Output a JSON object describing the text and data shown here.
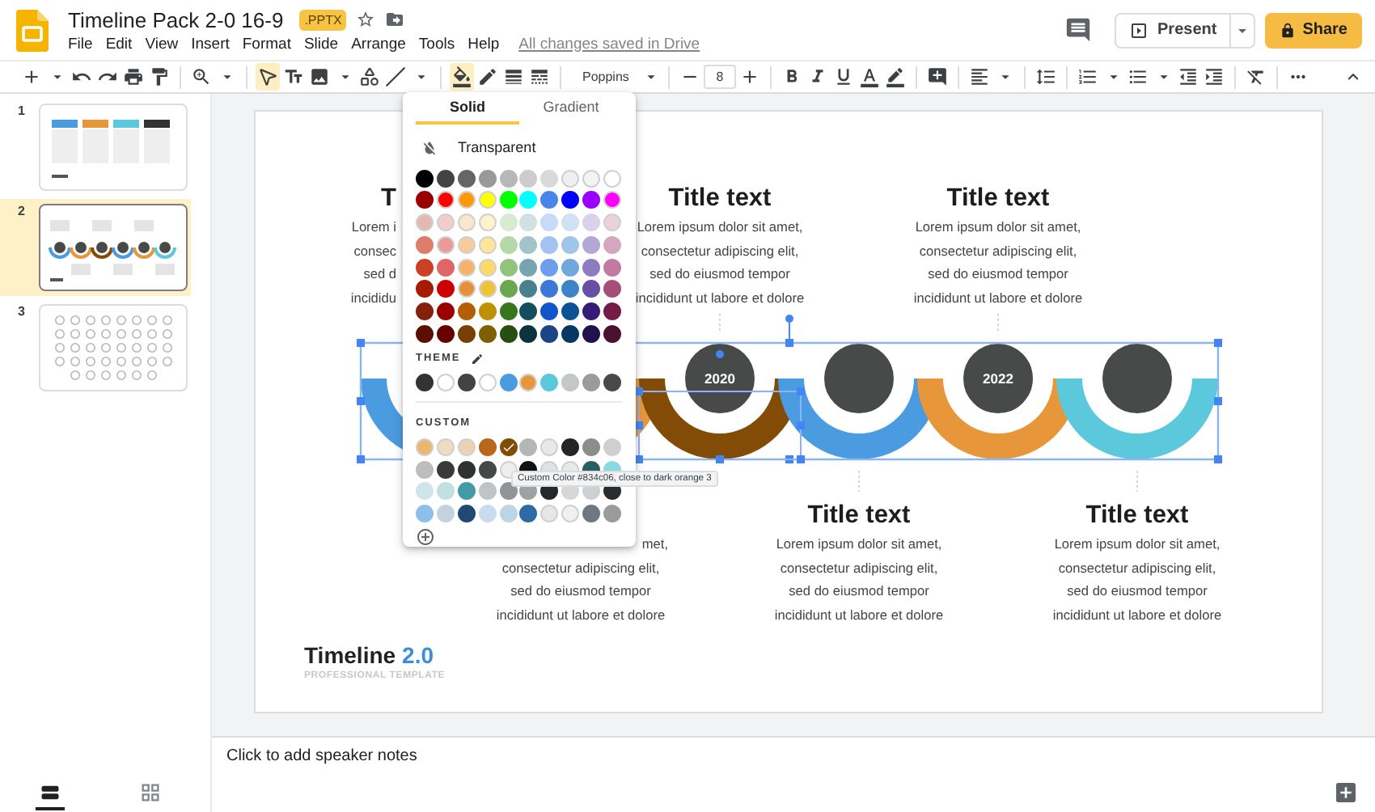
{
  "header": {
    "title": "Timeline Pack 2-0 16-9",
    "badge": ".PPTX",
    "menus": [
      "File",
      "Edit",
      "View",
      "Insert",
      "Format",
      "Slide",
      "Arrange",
      "Tools",
      "Help"
    ],
    "save_status": "All changes saved in Drive",
    "present": "Present",
    "share": "Share"
  },
  "toolbar": {
    "select_selected": true,
    "fill_open": true,
    "font": "Poppins",
    "font_size": "8"
  },
  "slides": [
    {
      "number": "1",
      "kind": "cards",
      "selected": false
    },
    {
      "number": "2",
      "kind": "arcs",
      "selected": true
    },
    {
      "number": "3",
      "kind": "icons",
      "selected": false
    }
  ],
  "slide": {
    "timeline": [
      {
        "color": "#4a9be0",
        "title": "T",
        "lines": [
          "Lorem i",
          "consec",
          "sed d",
          "incididu"
        ]
      },
      {
        "color": "#e8963a",
        "lines": [
          "met,",
          "consectetur adipiscing elit,",
          "sed do eiusmod tempor",
          "incididunt ut labore et dolore"
        ]
      },
      {
        "color": "#834c06",
        "year": "2020",
        "title": "Title text",
        "lines": [
          "Lorem ipsum dolor sit amet,",
          "consectetur adipiscing elit,",
          "sed do eiusmod tempor",
          "incididunt ut labore et dolore"
        ]
      },
      {
        "color": "#4a9be0",
        "title": "Title text",
        "lines": [
          "Lorem ipsum dolor sit amet,",
          "consectetur adipiscing elit,",
          "sed do eiusmod tempor",
          "incididunt ut labore et dolore"
        ]
      },
      {
        "color": "#e8963a",
        "year": "2022",
        "title": "Title text",
        "lines": [
          "Lorem ipsum dolor sit amet,",
          "consectetur adipiscing elit,",
          "sed do eiusmod tempor",
          "incididunt ut labore et dolore"
        ]
      },
      {
        "color": "#5bc8dc",
        "title": "Title text",
        "lines": [
          "Lorem ipsum dolor sit amet,",
          "consectetur adipiscing elit,",
          "sed do eiusmod tempor",
          "incididunt ut labore et dolore"
        ]
      }
    ],
    "brand": {
      "name": "Timeline",
      "version": "2.0",
      "subtitle": "PROFESSIONAL TEMPLATE"
    }
  },
  "color_picker": {
    "tabs": [
      {
        "label": "Solid",
        "selected": true
      },
      {
        "label": "Gradient",
        "selected": false
      }
    ],
    "transparent": "Transparent",
    "palette": [
      [
        {
          "color": "#000000"
        },
        {
          "color": "#434343"
        },
        {
          "color": "#666666"
        },
        {
          "color": "#999999"
        },
        {
          "color": "#b7b7b7"
        },
        {
          "color": "#cccccc"
        },
        {
          "color": "#d9d9d9"
        },
        {
          "color": "#efefef"
        },
        {
          "color": "#f3f3f3"
        },
        {
          "color": "#ffffff"
        }
      ],
      [
        {
          "color": "#980000"
        },
        {
          "color": "#ff0000"
        },
        {
          "color": "#ff9900"
        },
        {
          "color": "#ffff00"
        },
        {
          "color": "#00ff00"
        },
        {
          "color": "#00ffff"
        },
        {
          "color": "#4a86e8"
        },
        {
          "color": "#0000ff"
        },
        {
          "color": "#9900ff"
        },
        {
          "color": "#ff00ff"
        }
      ],
      [
        {
          "color": "#e6b8af"
        },
        {
          "color": "#f4cccc"
        },
        {
          "color": "#fce5cd"
        },
        {
          "color": "#fff2cc"
        },
        {
          "color": "#d9ead3"
        },
        {
          "color": "#d0e0e3"
        },
        {
          "color": "#c9daf8"
        },
        {
          "color": "#cfe2f3"
        },
        {
          "color": "#d9d2e9"
        },
        {
          "color": "#ead1dc"
        }
      ],
      [
        {
          "color": "#dd7e6b"
        },
        {
          "color": "#ea9999"
        },
        {
          "color": "#f9cb9c"
        },
        {
          "color": "#ffe599"
        },
        {
          "color": "#b6d7a8"
        },
        {
          "color": "#a2c4c9"
        },
        {
          "color": "#a4c2f4"
        },
        {
          "color": "#9fc5e8"
        },
        {
          "color": "#b4a7d6"
        },
        {
          "color": "#d5a6bd"
        }
      ],
      [
        {
          "color": "#cc4125"
        },
        {
          "color": "#e06666"
        },
        {
          "color": "#f6b26b"
        },
        {
          "color": "#ffd966"
        },
        {
          "color": "#93c47d"
        },
        {
          "color": "#76a5af"
        },
        {
          "color": "#6d9eeb"
        },
        {
          "color": "#6fa8dc"
        },
        {
          "color": "#8e7cc3"
        },
        {
          "color": "#c27ba0"
        }
      ],
      [
        {
          "color": "#a61c00"
        },
        {
          "color": "#cc0000"
        },
        {
          "color": "#e69138"
        },
        {
          "color": "#f1c232"
        },
        {
          "color": "#6aa84f"
        },
        {
          "color": "#45818e"
        },
        {
          "color": "#3c78d8"
        },
        {
          "color": "#3d85c6"
        },
        {
          "color": "#674ea7"
        },
        {
          "color": "#a64d79"
        }
      ],
      [
        {
          "color": "#85200c"
        },
        {
          "color": "#990000"
        },
        {
          "color": "#b45f06"
        },
        {
          "color": "#bf9000"
        },
        {
          "color": "#38761d"
        },
        {
          "color": "#134f5c"
        },
        {
          "color": "#1155cc"
        },
        {
          "color": "#0b5394"
        },
        {
          "color": "#351c75"
        },
        {
          "color": "#741b47"
        }
      ],
      [
        {
          "color": "#5b0f00"
        },
        {
          "color": "#660000"
        },
        {
          "color": "#783f04"
        },
        {
          "color": "#7f6000"
        },
        {
          "color": "#274e13"
        },
        {
          "color": "#0c343d"
        },
        {
          "color": "#1c4587"
        },
        {
          "color": "#073763"
        },
        {
          "color": "#20124d"
        },
        {
          "color": "#4c1130"
        }
      ]
    ],
    "theme_label": "THEME",
    "theme": [
      {
        "color": "#333333"
      },
      {
        "color": "#ffffff"
      },
      {
        "color": "#434343"
      },
      {
        "color": "#ffffff"
      },
      {
        "color": "#4a9be0"
      },
      {
        "color": "#e8963a"
      },
      {
        "color": "#5bc8dc"
      },
      {
        "color": "#c4c7c7"
      },
      {
        "color": "#9a9c9c"
      },
      {
        "color": "#474a49"
      }
    ],
    "custom_label": "CUSTOM",
    "custom": [
      [
        {
          "color": "#edb66f",
          "selected": false
        },
        {
          "color": "#f0dcc0",
          "selected": false
        },
        {
          "color": "#ead2b2",
          "selected": false
        },
        {
          "color": "#b8671d",
          "selected": false
        },
        {
          "color": "#834c06",
          "selected": true
        },
        {
          "color": "#b4b7b6",
          "selected": false
        },
        {
          "color": "#e8e8e8",
          "selected": false
        },
        {
          "color": "#252525",
          "selected": false
        },
        {
          "color": "#8b8e8d",
          "selected": false
        },
        {
          "color": "#cfcfcf",
          "selected": false
        }
      ],
      [
        {
          "color": "#bdbdbd",
          "selected": false
        },
        {
          "color": "#383b3a",
          "selected": false
        },
        {
          "color": "#2f3231",
          "selected": false
        },
        {
          "color": "#454848",
          "selected": false
        },
        {
          "color": "#eeeeee",
          "selected": false
        },
        {
          "color": "#111111",
          "selected": false
        },
        {
          "color": "#e0e0e0",
          "selected": false
        },
        {
          "color": "#e8e8e8",
          "selected": false
        },
        {
          "color": "#2a5f62",
          "selected": false
        },
        {
          "color": "#8ad8e0",
          "selected": false
        }
      ],
      [
        {
          "color": "#cfe5e9",
          "selected": false
        },
        {
          "color": "#c1e0e4",
          "selected": false
        },
        {
          "color": "#4598a6",
          "selected": false
        },
        {
          "color": "#bfc4c6",
          "selected": false
        },
        {
          "color": "#8f9596",
          "selected": false
        },
        {
          "color": "#9ea2a3",
          "selected": false
        },
        {
          "color": "#25282a",
          "selected": false
        },
        {
          "color": "#d6d8d8",
          "selected": false
        },
        {
          "color": "#cfd0d1",
          "selected": false
        },
        {
          "color": "#2a2d2f",
          "selected": false
        }
      ],
      [
        {
          "color": "#8cc0ea",
          "selected": false
        },
        {
          "color": "#c3d2de",
          "selected": false
        },
        {
          "color": "#1f4a72",
          "selected": false
        },
        {
          "color": "#c9dcee",
          "selected": false
        },
        {
          "color": "#bcd4e6",
          "selected": false
        },
        {
          "color": "#2d6aa6",
          "selected": false
        },
        {
          "color": "#e4e6e8",
          "selected": false
        },
        {
          "color": "#eff0f1",
          "selected": false
        },
        {
          "color": "#6f7780",
          "selected": false
        },
        {
          "color": "#9a9b9b",
          "selected": false
        }
      ]
    ],
    "tooltip": "Custom Color #834c06, close to dark orange 3"
  },
  "notes": {
    "placeholder": "Click to add speaker notes"
  },
  "view_toggle": [
    {
      "selected": true
    },
    {
      "selected": false
    }
  ]
}
